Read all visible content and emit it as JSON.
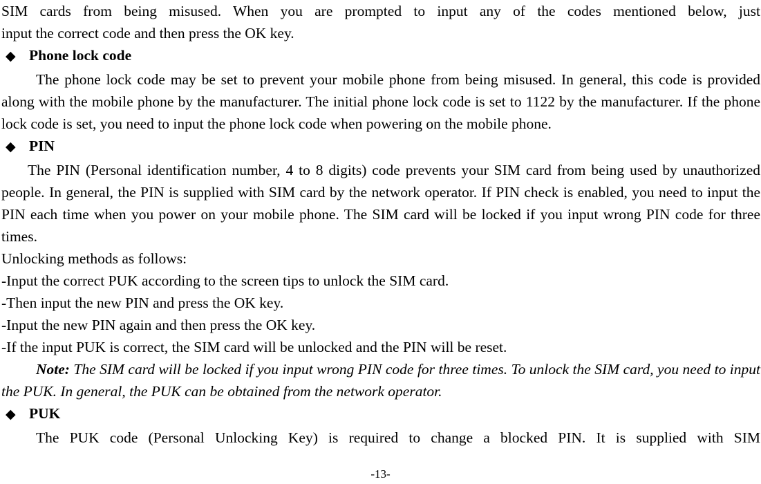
{
  "document": {
    "page_number_label": "-13-"
  },
  "content": {
    "intro_paragraph": "SIM cards from being misused. When you are prompted to input any of the codes mentioned below, just",
    "intro_paragraph_line2": "input the correct code and then press the OK key.",
    "sections": [
      {
        "bullet": "◆",
        "heading": "Phone lock code",
        "body": "The phone lock code may be set to prevent your mobile phone from being misused. In general, this code is provided along with the mobile phone by the manufacturer. The initial phone lock code is set to 1122 by the manufacturer. If the phone lock code is set, you need to input the phone lock code when powering on the mobile phone."
      },
      {
        "bullet": "◆",
        "heading": "PIN",
        "body": "The PIN (Personal identification number, 4 to 8 digits) code prevents your SIM card from being used by unauthorized people. In general, the PIN is supplied with SIM card by the network operator. If PIN check is enabled, you need to input the PIN each time when you power on your mobile phone. The SIM card will be locked if you input wrong PIN code for three times."
      },
      {
        "bullet": "◆",
        "heading": "PUK",
        "body": "The PUK code (Personal Unlocking Key) is required to change a blocked PIN. It is supplied with SIM"
      }
    ],
    "unlocking": {
      "intro": "Unlocking methods as follows:",
      "steps": [
        "-Input the correct PUK according to the screen tips to unlock the SIM card.",
        "-Then input the new PIN and press the OK key.",
        "-Input the new PIN again and then press the OK key.",
        "-If the input PUK is correct, the SIM card will be unlocked and the PIN will be reset."
      ]
    },
    "note": {
      "lead": "Note:",
      "text": " The SIM card will be locked if you input wrong PIN code for three times. To unlock the SIM card, you need to input the PUK. In general, the PUK can be obtained from the network operator."
    }
  },
  "colors": {
    "text": "#000000",
    "background": "#ffffff"
  }
}
